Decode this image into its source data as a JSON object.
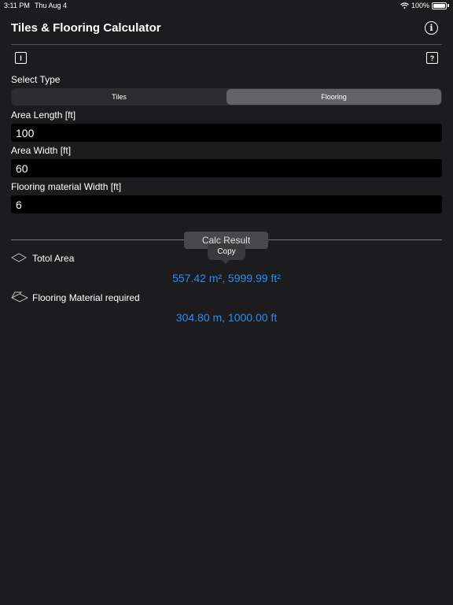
{
  "status": {
    "time": "3:11 PM",
    "date": "Thu Aug 4",
    "battery": "100%"
  },
  "nav": {
    "title": "Tiles & Flooring Calculator"
  },
  "select_type": {
    "label": "Select Type",
    "options": [
      "Tiles",
      "Flooring"
    ],
    "selected": "Flooring"
  },
  "fields": {
    "length_label": "Area Length [ft]",
    "length_value": "100",
    "width_label": "Area Width [ft]",
    "width_value": "60",
    "material_label": "Flooring material Width [ft]",
    "material_value": "6"
  },
  "calc": {
    "button": "Calc Result",
    "tooltip": "Copy"
  },
  "results": {
    "total_area_label": "Totol Area",
    "total_area_value": "557.42 m², 5999.99 ft²",
    "material_label": "Flooring Material required",
    "material_value": "304.80 m, 1000.00 ft"
  },
  "colors": {
    "background": "#1c1c1e",
    "accent": "#2f8cf3",
    "field_bg": "#000000"
  },
  "icons": [
    "wifi-icon",
    "battery-icon",
    "info-icon",
    "clear-icon",
    "help-icon",
    "area-icon",
    "flooring-icon"
  ]
}
